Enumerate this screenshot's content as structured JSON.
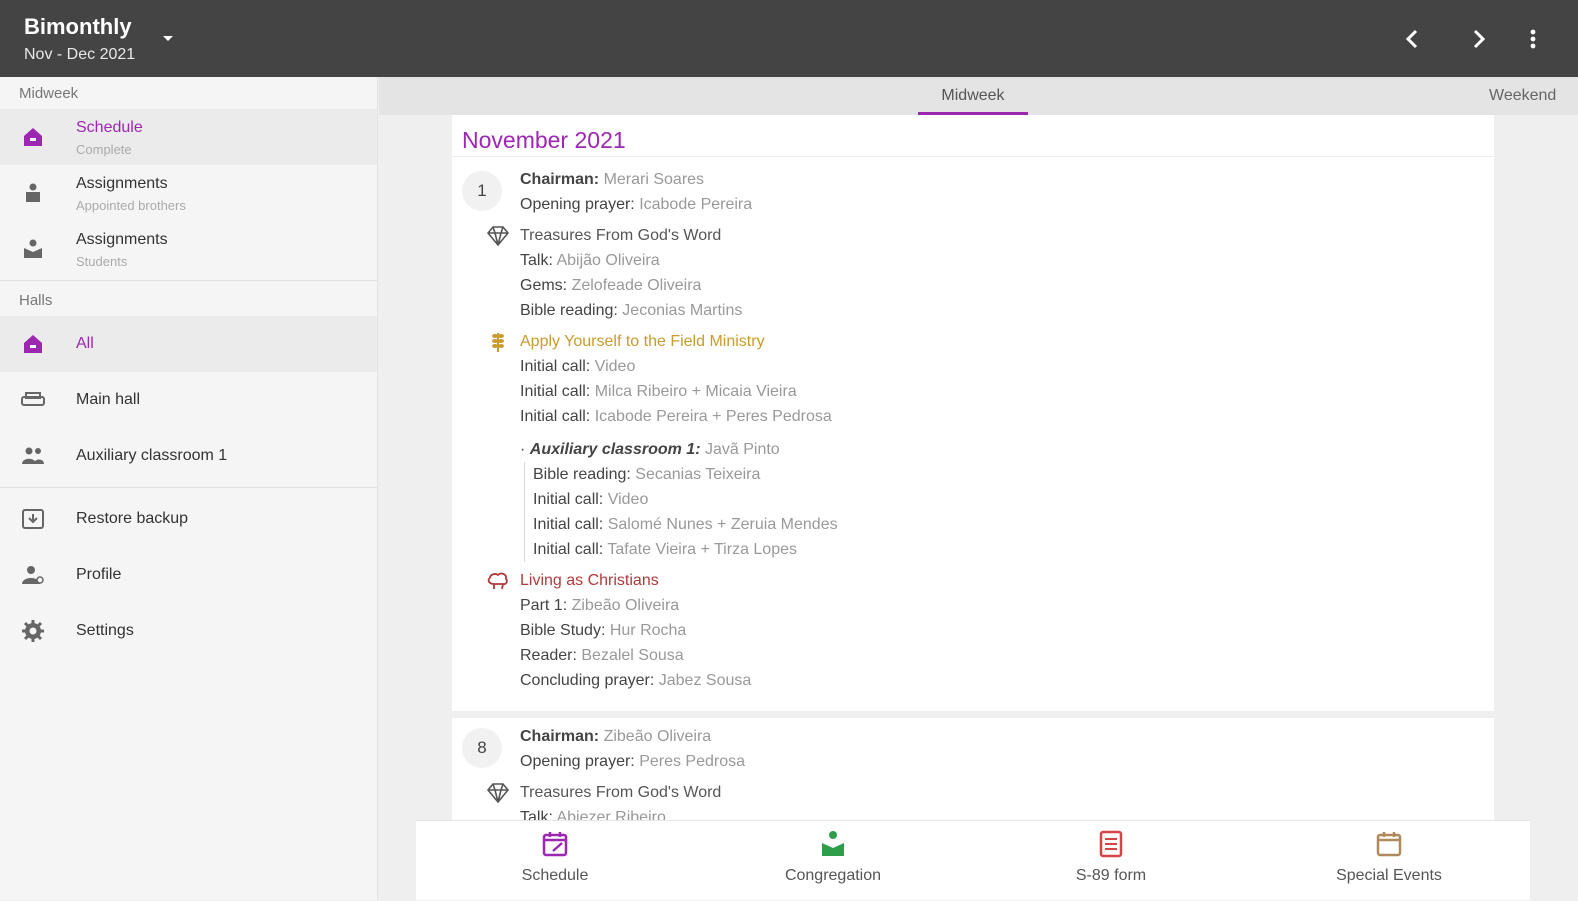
{
  "appbar": {
    "title": "Bimonthly",
    "subtitle": "Nov - Dec 2021"
  },
  "sidebar": {
    "midweek_header": "Midweek",
    "midweek_items": [
      {
        "label": "Schedule",
        "sub": "Complete",
        "icon": "home-icon"
      },
      {
        "label": "Assignments",
        "sub": "Appointed brothers",
        "icon": "person-podium-icon"
      },
      {
        "label": "Assignments",
        "sub": "Students",
        "icon": "student-icon"
      }
    ],
    "halls_header": "Halls",
    "hall_items": [
      {
        "label": "All",
        "icon": "home-icon"
      },
      {
        "label": "Main hall",
        "icon": "sofa-icon"
      },
      {
        "label": "Auxiliary classroom 1",
        "icon": "group-icon"
      }
    ],
    "other_items": [
      {
        "label": "Restore backup",
        "icon": "restore-icon"
      },
      {
        "label": "Profile",
        "icon": "profile-icon"
      },
      {
        "label": "Settings",
        "icon": "gear-icon"
      }
    ]
  },
  "tabs": [
    {
      "label": "Midweek"
    },
    {
      "label": "Weekend"
    }
  ],
  "schedule": {
    "month": "November 2021",
    "week1": {
      "day": "1",
      "chairman_label": "Chairman:",
      "chairman": "Merari Soares",
      "opening_label": "Opening prayer:",
      "opening": "Icabode Pereira",
      "treasures_title": "Treasures From God's Word",
      "talk_label": "Talk:",
      "talk": "Abijão Oliveira",
      "gems_label": "Gems:",
      "gems": "Zelofeade Oliveira",
      "bible_label": "Bible reading:",
      "bible": "Jeconias Martins",
      "field_title": "Apply Yourself to the Field Ministry",
      "ic1_label": "Initial call:",
      "ic1": "Video",
      "ic2_label": "Initial call:",
      "ic2": "Milca Ribeiro + Micaia Vieira",
      "ic3_label": "Initial call:",
      "ic3": "Icabode Pereira + Peres Pedrosa",
      "aux_label": "Auxiliary classroom 1:",
      "aux_person": "Javã Pinto",
      "aux_bible_label": "Bible reading:",
      "aux_bible": "Secanias Teixeira",
      "aux_ic1_label": "Initial call:",
      "aux_ic1": "Video",
      "aux_ic2_label": "Initial call:",
      "aux_ic2": "Salomé Nunes + Zeruia Mendes",
      "aux_ic3_label": "Initial call:",
      "aux_ic3": "Tafate Vieira + Tirza Lopes",
      "living_title": "Living as Christians",
      "part1_label": "Part 1:",
      "part1": "Zibeão Oliveira",
      "study_label": "Bible Study:",
      "study": "Hur Rocha",
      "reader_label": "Reader:",
      "reader": "Bezalel Sousa",
      "closing_label": "Concluding prayer:",
      "closing": "Jabez Sousa"
    },
    "week2": {
      "day": "8",
      "chairman_label": "Chairman:",
      "chairman": "Zibeão Oliveira",
      "opening_label": "Opening prayer:",
      "opening": "Peres Pedrosa",
      "treasures_title": "Treasures From God's Word",
      "talk_label": "Talk:",
      "talk": "Abiezer Ribeiro"
    }
  },
  "bottom_nav": [
    {
      "label": "Schedule",
      "icon": "calendar-edit-icon",
      "color": "#9c27b0"
    },
    {
      "label": "Congregation",
      "icon": "congregation-icon",
      "color": "#2e9e4a"
    },
    {
      "label": "S-89 form",
      "icon": "form-icon",
      "color": "#d64545"
    },
    {
      "label": "Special Events",
      "icon": "calendar-icon",
      "color": "#b08a5c"
    }
  ],
  "colors": {
    "accent": "#9c27b0",
    "appbar": "#444444",
    "field": "#c99b2c",
    "living": "#b03a3a"
  }
}
